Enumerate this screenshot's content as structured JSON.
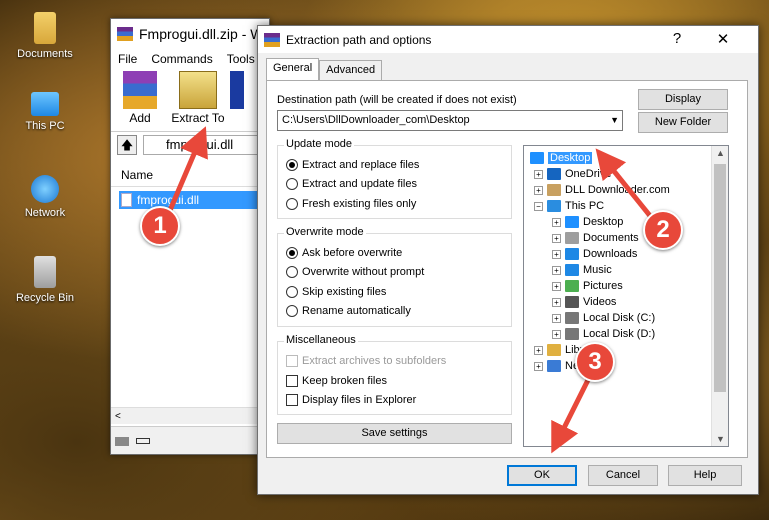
{
  "desktop": {
    "icons": [
      {
        "label": "Documents",
        "icon": "documents-folder-icon"
      },
      {
        "label": "This PC",
        "icon": "this-pc-icon"
      },
      {
        "label": "Network",
        "icon": "network-icon"
      },
      {
        "label": "Recycle Bin",
        "icon": "recycle-bin-icon"
      }
    ]
  },
  "winrar": {
    "title": "Fmprogui.dll.zip - W",
    "menu": [
      "File",
      "Commands",
      "Tools"
    ],
    "toolbar": [
      "Add",
      "Extract To",
      ""
    ],
    "address": "fmprogui.dll",
    "column_name": "Name",
    "file": "fmprogui.dll",
    "scroll_left": "<"
  },
  "dialog": {
    "title": "Extraction path and options",
    "help": "?",
    "close": "✕",
    "tabs": [
      "General",
      "Advanced"
    ],
    "dest_label": "Destination path (will be created if does not exist)",
    "dest_value": "C:\\Users\\DllDownloader_com\\Desktop",
    "display_btn": "Display",
    "new_folder_btn": "New Folder",
    "update_mode": {
      "title": "Update mode",
      "options": [
        "Extract and replace files",
        "Extract and update files",
        "Fresh existing files only"
      ],
      "selected": 0
    },
    "overwrite_mode": {
      "title": "Overwrite mode",
      "options": [
        "Ask before overwrite",
        "Overwrite without prompt",
        "Skip existing files",
        "Rename automatically"
      ],
      "selected": 0
    },
    "misc": {
      "title": "Miscellaneous",
      "options": [
        "Extract archives to subfolders",
        "Keep broken files",
        "Display files in Explorer"
      ],
      "disabled": [
        true,
        false,
        false
      ]
    },
    "save_settings": "Save settings",
    "tree": [
      {
        "label": "Desktop",
        "level": 0,
        "selected": true,
        "icon": "desktop-icon",
        "color": "#1e90ff"
      },
      {
        "label": "OneDrive",
        "level": 1,
        "icon": "onedrive-icon",
        "color": "#1565c0"
      },
      {
        "label": "DLL Downloader.com",
        "level": 1,
        "icon": "user-icon",
        "color": "#c8a060"
      },
      {
        "label": "This PC",
        "level": 1,
        "icon": "this-pc-icon",
        "color": "#2a8de0"
      },
      {
        "label": "Desktop",
        "level": 2,
        "icon": "desktop-icon",
        "color": "#1e90ff"
      },
      {
        "label": "Documents",
        "level": 2,
        "icon": "documents-icon",
        "color": "#9e9e9e"
      },
      {
        "label": "Downloads",
        "level": 2,
        "icon": "downloads-icon",
        "color": "#1e88e5"
      },
      {
        "label": "Music",
        "level": 2,
        "icon": "music-icon",
        "color": "#1e88e5"
      },
      {
        "label": "Pictures",
        "level": 2,
        "icon": "pictures-icon",
        "color": "#4caf50"
      },
      {
        "label": "Videos",
        "level": 2,
        "icon": "videos-icon",
        "color": "#555555"
      },
      {
        "label": "Local Disk (C:)",
        "level": 2,
        "icon": "disk-icon",
        "color": "#777777"
      },
      {
        "label": "Local Disk (D:)",
        "level": 2,
        "icon": "disk-icon",
        "color": "#777777"
      },
      {
        "label": "Libra",
        "level": 1,
        "icon": "libraries-icon",
        "color": "#e0b040"
      },
      {
        "label": "Ne",
        "level": 1,
        "icon": "network-icon",
        "color": "#3a7bd5"
      }
    ],
    "ok": "OK",
    "cancel": "Cancel",
    "help_btn": "Help"
  },
  "callouts": [
    "1",
    "2",
    "3"
  ],
  "colors": {
    "accent": "#0078d7",
    "selection": "#3399ff",
    "callout": "#e8483a"
  }
}
